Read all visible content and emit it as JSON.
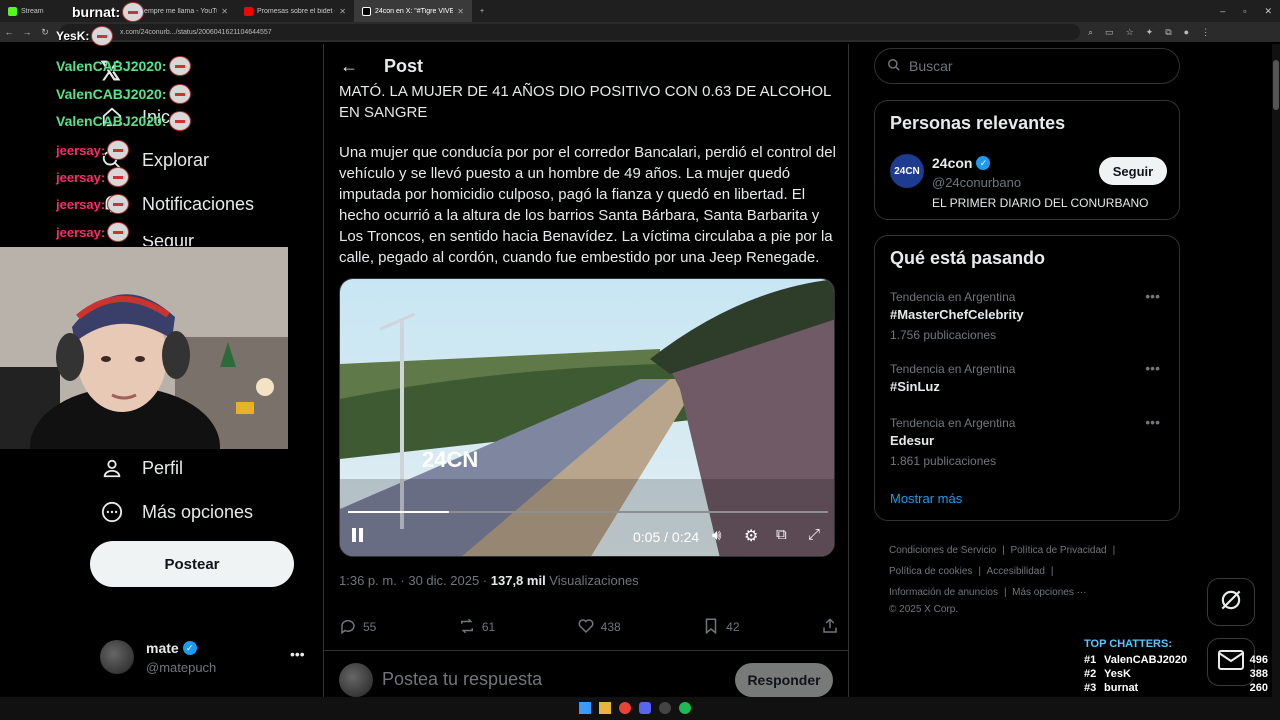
{
  "browser": {
    "tabs": [
      {
        "title": "Stream",
        "color": "#53fc18"
      },
      {
        "title": "siempre me llama - YouTube",
        "color": "#ff0000"
      },
      {
        "title": "Promesas sobre el bidet (fu",
        "color": "#ff0000"
      },
      {
        "title": "24con en X: \"#Tigre VIVE EN M",
        "color": "#ffffff"
      }
    ],
    "new_tab": "+",
    "url": "x.com/24conurb.../status/2006041621104644557"
  },
  "chat": {
    "lines": [
      {
        "user": "YesK:",
        "color": "#ffffff"
      },
      {
        "user": "ValenCABJ2020:",
        "color": "#57e389"
      },
      {
        "user": "ValenCABJ2020:",
        "color": "#57e389"
      },
      {
        "user": "ValenCABJ2020:",
        "color": "#57e389"
      },
      {
        "user": "jeersay:",
        "color": "#ff2a6d"
      },
      {
        "user": "jeersay:",
        "color": "#ff2a6d"
      },
      {
        "user": "jeersay:",
        "color": "#ff2a6d"
      },
      {
        "user": "jeersay:",
        "color": "#ff2a6d"
      }
    ],
    "streamer_tag": "burnat:"
  },
  "sidebar": {
    "items": {
      "home": "Inic",
      "explore": "Explorar",
      "notifications": "Notificaciones",
      "follow": "Seguir",
      "profile": "Perfil",
      "more": "Más opciones"
    },
    "post_button": "Postear",
    "account": {
      "name": "mate",
      "handle": "@matepuch"
    }
  },
  "post": {
    "header": "Post",
    "headline": "MATÓ. LA MUJER DE 41 AÑOS DIO POSITIVO CON 0.63 DE ALCOHOL EN SANGRE",
    "body": "Una mujer que conducía por por el corredor Bancalari, perdió el control del vehículo y se llevó puesto a un hombre de 49 años. La mujer quedó imputada por homicidio culposo, pagó la fianza y quedó en libertad. El hecho ocurrió a la altura de los barrios Santa Bárbara, Santa Barbarita y Los Troncos, en sentido hacia Benavídez. La víctima circulaba a pie por la calle, pegado al cordón, cuando fue embestido por una Jeep Renegade.",
    "video": {
      "watermark": "24CN",
      "time": "0:05 / 0:24",
      "progress": 0.21
    },
    "timestamp": "1:36 p. m. · 30 dic. 2025 · ",
    "views_count": "137,8 mil",
    "views_label": " Visualizaciones",
    "actions": {
      "replies": "55",
      "reposts": "61",
      "likes": "438",
      "bookmarks": "42"
    },
    "reply_placeholder": "Postea tu respuesta",
    "reply_button": "Responder"
  },
  "right": {
    "search_placeholder": "Buscar",
    "relevant": {
      "title": "Personas relevantes",
      "name": "24con",
      "handle": "@24conurbano",
      "bio": "EL PRIMER DIARIO DEL CONURBANO",
      "follow": "Seguir",
      "avatar_text": "24CN"
    },
    "trending": {
      "title": "Qué está pasando",
      "items": [
        {
          "context": "Tendencia en Argentina",
          "name": "#MasterChefCelebrity",
          "count": "1.756 publicaciones"
        },
        {
          "context": "Tendencia en Argentina",
          "name": "#SinLuz",
          "count": ""
        },
        {
          "context": "Tendencia en Argentina",
          "name": "Edesur",
          "count": "1.861 publicaciones"
        }
      ],
      "show_more": "Mostrar más"
    },
    "footer": {
      "links": [
        "Condiciones de Servicio",
        "Política de Privacidad",
        "Política de cookies",
        "Accesibilidad",
        "Información de anuncios",
        "Más opciones ···"
      ],
      "copyright": "© 2025 X Corp."
    }
  },
  "top_chatters": {
    "title": "TOP CHATTERS:",
    "entries": [
      {
        "rank": "#1",
        "name": "ValenCABJ2020",
        "count": "496"
      },
      {
        "rank": "#2",
        "name": "YesK",
        "count": "388"
      },
      {
        "rank": "#3",
        "name": "burnat",
        "count": "260"
      }
    ]
  },
  "colors": {
    "accent": "#1d9bf0",
    "verified": "#1d9bf0",
    "link": "#1d9bf0"
  }
}
